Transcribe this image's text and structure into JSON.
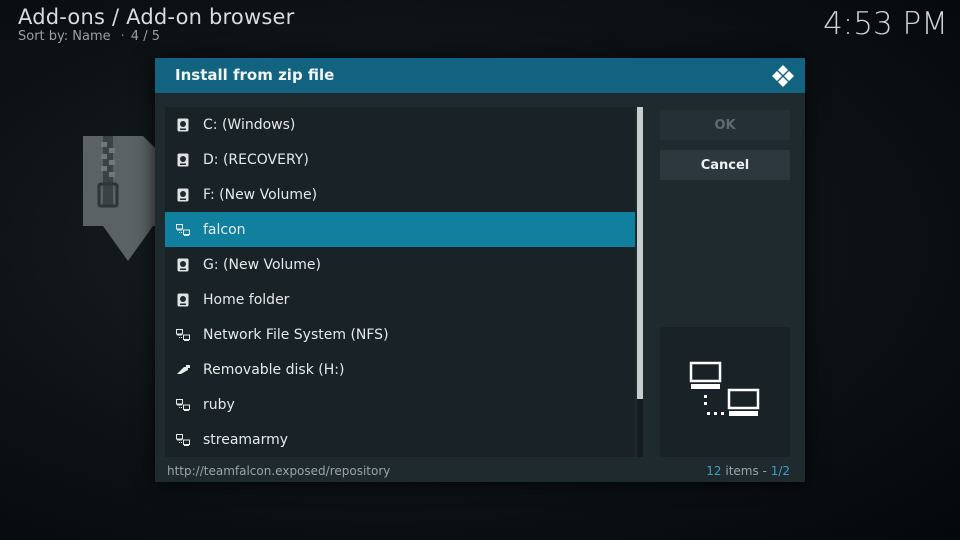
{
  "header": {
    "title": "Add-ons / Add-on browser",
    "sort_label": "Sort by: Name",
    "position": "4 / 5",
    "clock": "4:53 PM"
  },
  "dialog": {
    "title": "Install from zip file",
    "items": [
      {
        "label": "C: (Windows)",
        "icon": "hard-drive-icon",
        "selected": false
      },
      {
        "label": "D: (RECOVERY)",
        "icon": "hard-drive-icon",
        "selected": false
      },
      {
        "label": "F: (New Volume)",
        "icon": "hard-drive-icon",
        "selected": false
      },
      {
        "label": "falcon",
        "icon": "network-icon",
        "selected": true
      },
      {
        "label": "G: (New Volume)",
        "icon": "hard-drive-icon",
        "selected": false
      },
      {
        "label": "Home folder",
        "icon": "hard-drive-icon",
        "selected": false
      },
      {
        "label": "Network File System (NFS)",
        "icon": "network-icon",
        "selected": false
      },
      {
        "label": "Removable disk (H:)",
        "icon": "usb-icon",
        "selected": false
      },
      {
        "label": "ruby",
        "icon": "network-icon",
        "selected": false
      },
      {
        "label": "streamarmy",
        "icon": "network-icon",
        "selected": false
      }
    ],
    "ok_label": "OK",
    "cancel_label": "Cancel",
    "status_path": "http://teamfalcon.exposed/repository",
    "item_count": "12",
    "item_count_suffix": " items - ",
    "page": "1/2"
  },
  "colors": {
    "accent": "#12637f",
    "selected": "#11809e",
    "dialog_bg": "#1f2a2f"
  }
}
